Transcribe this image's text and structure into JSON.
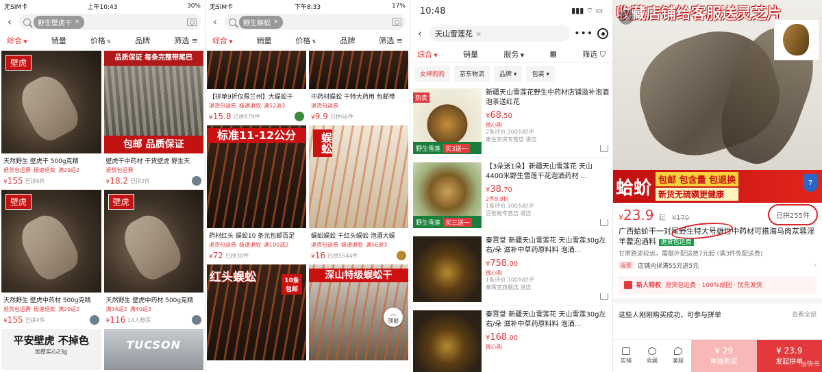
{
  "panel1": {
    "status": {
      "carrier": "无SIM卡",
      "time": "上午10:43",
      "battery": "30%"
    },
    "search_chip": "野生壁虎干",
    "sort_tabs": [
      "综合",
      "销量",
      "价格",
      "品牌",
      "筛选"
    ],
    "products": [
      {
        "badge": "壁虎",
        "title": "天然野生 壁虎干 500g克精",
        "tags": [
          "退货包运费",
          "极速退款",
          "满29返2"
        ],
        "price": "155",
        "sold": "已拼6件"
      },
      {
        "banner_top": "品质保证   每条完整带尾巴",
        "banner_bottom": "包邮     品质保证",
        "title": "壁虎干中药材 干货壁虎 野生天",
        "tags": [
          "退货包运费"
        ],
        "price": "18.2",
        "sold": "已拼2件"
      },
      {
        "badge": "壁虎",
        "title": "天然野生 壁虎中药材 500g克精",
        "tags": [
          "退货包运费",
          "极速退款",
          "满29返2"
        ],
        "price": "155",
        "sold": "已拼4件"
      },
      {
        "badge": "壁虎",
        "title": "天然野生 壁虎中药材 500g克精",
        "tags": [
          "满34返2",
          "满40返3"
        ],
        "price": "116",
        "sold": "14人想买"
      },
      {
        "banner_top": "平安壁虎  不掉色",
        "sub": "加厚实心23g"
      },
      {
        "banner_top": "TUCSON"
      }
    ]
  },
  "panel2": {
    "status": {
      "carrier": "无SIM卡",
      "time": "下午8:33",
      "battery": "17%"
    },
    "search_chip": "野生蜈蚣",
    "sort_tabs": [
      "综合",
      "销量",
      "价格",
      "品牌",
      "筛选"
    ],
    "products": [
      {
        "title": "【拼单9折仅限兰州】大蜈蚣干",
        "tags": [
          "退货包运费",
          "极速退款",
          "满52返3"
        ],
        "price": "15.8",
        "sold": "已拼879件"
      },
      {
        "title": "中药材蜈蚣 干特大药用 包邮带",
        "tags": [
          "退货包运费"
        ],
        "price": "9.9",
        "sold": "已拼66件"
      },
      {
        "banner_top": "标准11-12公分",
        "title": "药材红头 蜈蚣10 条元包邮百足",
        "tags": [
          "退货包运费",
          "极速退款",
          "满100减2"
        ],
        "price": "72",
        "sold": "已拼30件"
      },
      {
        "banner_top": "蜈蚣",
        "title": "蜈蚣蜈蚣 干红头蜈蚣 泡酒大蜈",
        "tags": [
          "退货包运费",
          "极速退款",
          "满56返3"
        ],
        "price": "16",
        "sold": "已拼5544件"
      },
      {
        "banner_top": "红头蜈蚣",
        "sub": "10条 包邮"
      },
      {
        "banner_top": "深山特级蜈蚣干"
      }
    ],
    "top_button": "顶部"
  },
  "panel3": {
    "time": "10:48",
    "search_chip": "天山雪莲花",
    "sort_tabs": [
      "综合",
      "销量",
      "服务",
      "筛选"
    ],
    "filters": [
      "女神购购",
      "京东物流",
      "品牌",
      "包装"
    ],
    "items": [
      {
        "hot": "热卖",
        "strip": "野生雪莲",
        "strip_red": "买3送一",
        "title": "新疆天山雪莲花野生中药材店铺滋补泡酒泡茶送红花",
        "price": "68",
        "price_dec": ".50",
        "sub": "放心购",
        "meta": "2条评价 100%好评",
        "shop": "康生农资专营店 进店"
      },
      {
        "hot": "",
        "strip": "野生雪莲",
        "strip_red": "买三送一",
        "title": "【3朵送1朵】新疆天山雪莲花 天山4400米野生雪莲干花泡酒药材 ...",
        "price": "38",
        "price_dec": ".70",
        "sub": "2件9.8折",
        "meta": "1条评价 100%好评",
        "shop": "百智格专营店 进店"
      },
      {
        "hot": "",
        "strip": "",
        "strip_red": "",
        "title": "秦霄堂 新疆天山雪莲花 天山雪莲30g左右/朵 滋补中草药原料料 泡酒...",
        "price": "758",
        "price_dec": ".00",
        "sub": "放心购",
        "meta": "1条评价 100%好评",
        "shop": "秦霄堂旗舰店 进店"
      },
      {
        "hot": "",
        "strip": "",
        "strip_red": "",
        "title": "秦霄堂 新疆天山雪莲花 天山雪莲30g左右/朵 滋补中草药原料料 泡酒...",
        "price": "168",
        "price_dec": ".00",
        "sub": "放心购",
        "meta": "",
        "shop": ""
      }
    ]
  },
  "panel4": {
    "hero_title": "收藏店铺给客服送灵芝片",
    "promo_big": "蛤蚧",
    "promo_line1": "包邮 包含量 包退换",
    "promo_line2": "新货无硫磺更健康",
    "price": "23.9",
    "price_suffix": "起",
    "orig_price": "¥170",
    "sold": "已拼255件",
    "title": "广西蛤蚧干一对尾野生特大号雄性中药材可搭海马肉苁蓉淫羊藿泡酒料",
    "title_tag": "退货包运费",
    "shipping": "甘肃路途较远，需额外配送费7元起 (满3件免配送费)",
    "return_label": "返现",
    "return_text": "店铺内拼满55元返5元",
    "new_user_label": "新人特权",
    "new_user_text": "退货包运费 · 100%成团 · 优先发货",
    "group_text": "这些人刚刚购买成功，可参与拼单",
    "group_more": "查看全部",
    "nav": [
      "店铺",
      "收藏",
      "客服"
    ],
    "buy_single_price": "¥ 29",
    "buy_single_label": "单独购买",
    "buy_group_price": "¥ 23.9",
    "buy_group_label": "发起拼单",
    "watermark": "@快书"
  }
}
